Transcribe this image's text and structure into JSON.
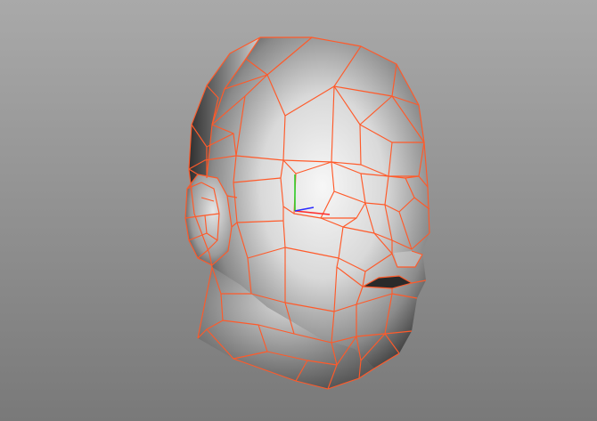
{
  "viewport": {
    "background_top": "#a9a9a9",
    "background_bottom": "#797979"
  },
  "scene": {
    "object": "head-mesh",
    "shading": "smooth-gray",
    "wireframe_overlay": true,
    "wireframe_color": "#ff5a2a",
    "surface_light": "#f4f4f4",
    "surface_dark": "#3a3a3a"
  },
  "gizmo": {
    "axes": [
      {
        "name": "x",
        "color": "#ff2a2a"
      },
      {
        "name": "y",
        "color": "#2bd12b"
      },
      {
        "name": "z",
        "color": "#2a2aff"
      }
    ]
  }
}
